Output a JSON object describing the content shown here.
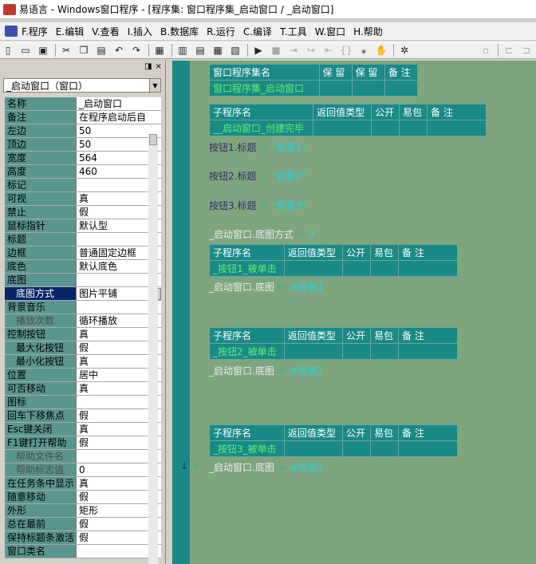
{
  "window": {
    "title": "易语言 - Windows窗口程序 - [程序集: 窗口程序集_启动窗口 / _启动窗口]"
  },
  "menu": [
    "F.程序",
    "E.编辑",
    "V.查看",
    "I.插入",
    "B.数据库",
    "R.运行",
    "C.编译",
    "T.工具",
    "W.窗口",
    "H.帮助"
  ],
  "toolbar": {
    "buttons": [
      "new",
      "open",
      "save",
      "cut",
      "copy",
      "paste",
      "undo",
      "redo",
      "find",
      "layout1",
      "layout2",
      "layout3",
      "layout4",
      "run",
      "stop",
      "step-in",
      "step-over",
      "step-out",
      "step-into-func",
      "breakpoint",
      "hand",
      "debug",
      "disabled1",
      "disabled2",
      "disabled3"
    ]
  },
  "panel": {
    "close_label": "×",
    "combo_value": "_启动窗口（窗口）",
    "rows": [
      {
        "k": "名称",
        "v": "_启动窗口"
      },
      {
        "k": "备注",
        "v": "在程序启动后自"
      },
      {
        "k": "左边",
        "v": "50"
      },
      {
        "k": "顶边",
        "v": "50"
      },
      {
        "k": "宽度",
        "v": "564"
      },
      {
        "k": "高度",
        "v": "460"
      },
      {
        "k": "标记",
        "v": ""
      },
      {
        "k": "可视",
        "v": "真"
      },
      {
        "k": "禁止",
        "v": "假"
      },
      {
        "k": "鼠标指针",
        "v": "默认型"
      },
      {
        "k": "标题",
        "v": ""
      },
      {
        "k": "边框",
        "v": "普通固定边框"
      },
      {
        "k": "底色",
        "v": "默认底色"
      },
      {
        "k": "底图",
        "v": ""
      },
      {
        "k": "底图方式",
        "v": "图片平铺",
        "sel": true
      },
      {
        "k": "背景音乐",
        "v": ""
      },
      {
        "k": "播放次数",
        "v": "循环播放",
        "dis": true
      },
      {
        "k": "控制按钮",
        "v": "真"
      },
      {
        "k": "最大化按钮",
        "v": "假",
        "sub": true
      },
      {
        "k": "最小化按钮",
        "v": "真",
        "sub": true
      },
      {
        "k": "位置",
        "v": "居中"
      },
      {
        "k": "可否移动",
        "v": "真"
      },
      {
        "k": "图标",
        "v": ""
      },
      {
        "k": "回车下移焦点",
        "v": "假"
      },
      {
        "k": "Esc键关闭",
        "v": "真"
      },
      {
        "k": "F1键打开帮助",
        "v": "假"
      },
      {
        "k": "帮助文件名",
        "v": "",
        "dis": true
      },
      {
        "k": "帮助标志值",
        "v": "0",
        "dis": true
      },
      {
        "k": "在任务条中显示",
        "v": "真"
      },
      {
        "k": "随意移动",
        "v": "假"
      },
      {
        "k": "外形",
        "v": "矩形"
      },
      {
        "k": "总在最前",
        "v": "假"
      },
      {
        "k": "保持标题条激活",
        "v": "假"
      },
      {
        "k": "窗口类名",
        "v": ""
      }
    ]
  },
  "editor": {
    "assembly": {
      "headers": [
        "窗口程序集名",
        "保 留",
        "保 留",
        "备 注"
      ],
      "values": [
        "窗口程序集_启动窗口",
        "",
        "",
        ""
      ]
    },
    "sub_headers": [
      "子程序名",
      "返回值类型",
      "公开",
      "易包",
      "备 注"
    ],
    "sub_create": "__启动窗口_创建完毕",
    "code_lines": [
      {
        "obj": "按钮1",
        "prop": "标题",
        "op": "＝",
        "val": "\"背景1\""
      },
      {
        "obj": "按钮2",
        "prop": "标题",
        "op": "＝",
        "val": "\"背景2\""
      },
      {
        "obj": "按钮3",
        "prop": "标题",
        "op": "＝",
        "val": "\"背景3\""
      }
    ],
    "line_mode": {
      "obj": "_启动窗口",
      "prop": "底图方式",
      "op": "＝",
      "val": "3"
    },
    "handlers": [
      {
        "name": "_按钮1_被单击",
        "obj": "_启动窗口",
        "prop": "底图",
        "op": "＝",
        "val": "#背景1"
      },
      {
        "name": "_按钮2_被单击",
        "obj": "_启动窗口",
        "prop": "底图",
        "op": "＝",
        "val": "#背景2"
      },
      {
        "name": "_按钮3_被单击",
        "obj": "_启动窗口",
        "prop": "底图",
        "op": "＝",
        "val": "#背景3"
      }
    ],
    "dot": "."
  }
}
